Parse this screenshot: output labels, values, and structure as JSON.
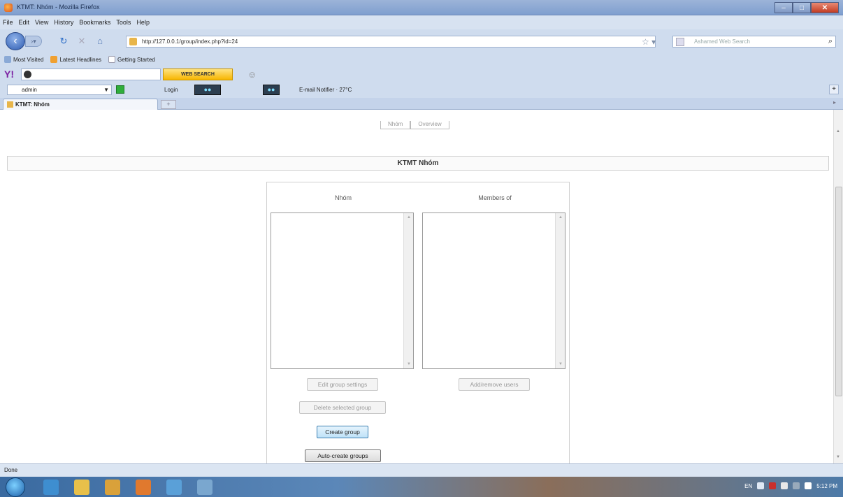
{
  "window": {
    "title": "KTMT: Nhóm - Mozilla Firefox"
  },
  "menu": [
    "File",
    "Edit",
    "View",
    "History",
    "Bookmarks",
    "Tools",
    "Help"
  ],
  "address": {
    "url": "http://127.0.0.1/group/index.php?id=24"
  },
  "search": {
    "placeholder": "Ashamed Web Search"
  },
  "bookmarks": [
    "Most Visited",
    "Latest Headlines",
    "Getting Started"
  ],
  "yahoo": {
    "button_label": "WEB SEARCH"
  },
  "toolbar": {
    "user": "admin",
    "login_label": "Login",
    "email_label": "E-mail Notifier",
    "temp": "27°C"
  },
  "tab": {
    "label": "KTMT: Nhóm"
  },
  "page": {
    "top_tabs": [
      "Nhóm",
      "Overview"
    ],
    "header": "KTMT Nhóm",
    "groups_title": "Nhóm",
    "members_title": "Members of",
    "buttons": {
      "edit_group": "Edit group settings",
      "delete_group": "Delete selected group",
      "create_group": "Create group",
      "auto_create": "Auto-create groups",
      "add_remove": "Add/remove users"
    }
  },
  "status": {
    "text": "Done"
  },
  "clock": "5:12 PM",
  "lang": "EN"
}
